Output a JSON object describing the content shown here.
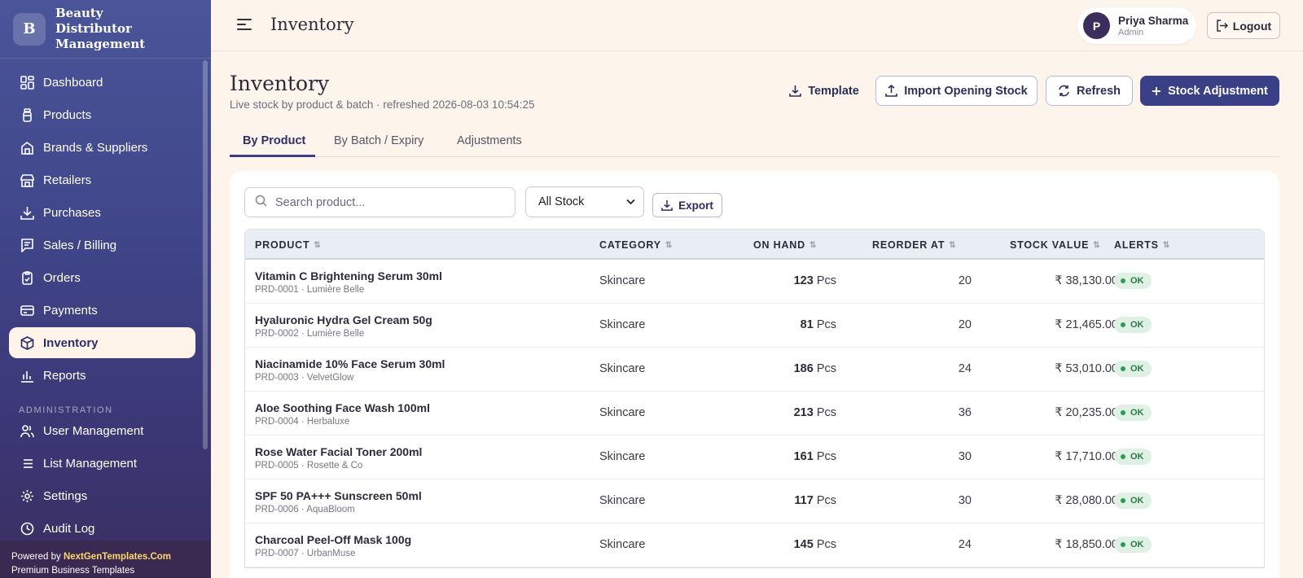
{
  "brand": {
    "logo_letter": "B",
    "name": "Beauty Distributor Management"
  },
  "sidebar": {
    "items": [
      {
        "label": "Dashboard",
        "icon": "dashboard-icon"
      },
      {
        "label": "Products",
        "icon": "bottle-icon"
      },
      {
        "label": "Brands & Suppliers",
        "icon": "building-icon"
      },
      {
        "label": "Retailers",
        "icon": "store-icon"
      },
      {
        "label": "Purchases",
        "icon": "download-icon"
      },
      {
        "label": "Sales / Billing",
        "icon": "receipt-icon"
      },
      {
        "label": "Orders",
        "icon": "clipboard-icon"
      },
      {
        "label": "Payments",
        "icon": "card-icon"
      },
      {
        "label": "Inventory",
        "icon": "box-icon",
        "active": true
      },
      {
        "label": "Reports",
        "icon": "bar-chart-icon"
      }
    ],
    "section_label": "ADMINISTRATION",
    "admin_items": [
      {
        "label": "User Management",
        "icon": "users-icon"
      },
      {
        "label": "List Management",
        "icon": "list-icon"
      },
      {
        "label": "Settings",
        "icon": "gear-icon"
      },
      {
        "label": "Audit Log",
        "icon": "clock-icon"
      }
    ],
    "powered_prefix": "Powered by ",
    "powered_brand": "NextGenTemplates.Com",
    "powered_tagline": "Premium Business Templates"
  },
  "topbar": {
    "title": "Inventory",
    "user": {
      "initial": "P",
      "name": "Priya Sharma",
      "role": "Admin"
    },
    "logout_label": "Logout"
  },
  "page": {
    "title": "Inventory",
    "subtitle": "Live stock by product & batch · refreshed 2026-08-03 10:54:25",
    "buttons": {
      "template": "Template",
      "import": "Import Opening Stock",
      "refresh": "Refresh",
      "adjust": "Stock Adjustment"
    },
    "tabs": [
      "By Product",
      "By Batch / Expiry",
      "Adjustments"
    ],
    "active_tab": 0
  },
  "filters": {
    "search_placeholder": "Search product...",
    "stock_filter": "All Stock",
    "export_label": "Export"
  },
  "table": {
    "columns": [
      "PRODUCT",
      "CATEGORY",
      "ON HAND",
      "REORDER AT",
      "STOCK VALUE",
      "ALERTS"
    ],
    "rows": [
      {
        "name": "Vitamin C Brightening Serum 30ml",
        "meta": "PRD-0001 · Lumière Belle",
        "category": "Skincare",
        "qty": "123",
        "unit": "Pcs",
        "reorder": "20",
        "value": "₹ 38,130.00",
        "alert": "OK"
      },
      {
        "name": "Hyaluronic Hydra Gel Cream 50g",
        "meta": "PRD-0002 · Lumière Belle",
        "category": "Skincare",
        "qty": "81",
        "unit": "Pcs",
        "reorder": "20",
        "value": "₹ 21,465.00",
        "alert": "OK"
      },
      {
        "name": "Niacinamide 10% Face Serum 30ml",
        "meta": "PRD-0003 · VelvetGlow",
        "category": "Skincare",
        "qty": "186",
        "unit": "Pcs",
        "reorder": "24",
        "value": "₹ 53,010.00",
        "alert": "OK"
      },
      {
        "name": "Aloe Soothing Face Wash 100ml",
        "meta": "PRD-0004 · Herbaluxe",
        "category": "Skincare",
        "qty": "213",
        "unit": "Pcs",
        "reorder": "36",
        "value": "₹ 20,235.00",
        "alert": "OK"
      },
      {
        "name": "Rose Water Facial Toner 200ml",
        "meta": "PRD-0005 · Rosette & Co",
        "category": "Skincare",
        "qty": "161",
        "unit": "Pcs",
        "reorder": "30",
        "value": "₹ 17,710.00",
        "alert": "OK"
      },
      {
        "name": "SPF 50 PA+++ Sunscreen 50ml",
        "meta": "PRD-0006 · AquaBloom",
        "category": "Skincare",
        "qty": "117",
        "unit": "Pcs",
        "reorder": "30",
        "value": "₹ 28,080.00",
        "alert": "OK"
      },
      {
        "name": "Charcoal Peel-Off Mask 100g",
        "meta": "PRD-0007 · UrbanMuse",
        "category": "Skincare",
        "qty": "145",
        "unit": "Pcs",
        "reorder": "24",
        "value": "₹ 18,850.00",
        "alert": "OK"
      }
    ]
  },
  "colors": {
    "primary": "#3a3f86",
    "ok_badge": "#dff0e4",
    "page_bg": "#fdf4ec"
  }
}
